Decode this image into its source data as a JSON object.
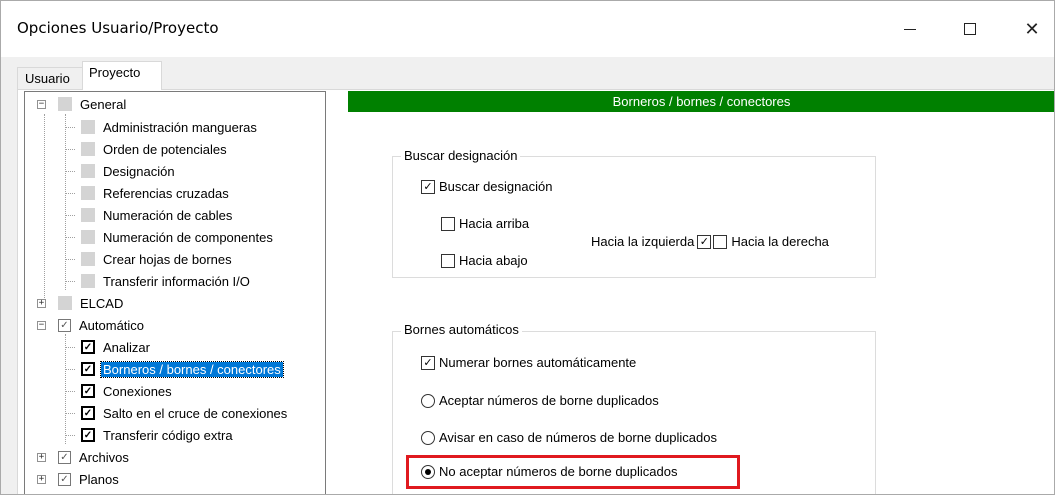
{
  "window": {
    "title": "Opciones Usuario/Proyecto"
  },
  "controls": {
    "minimize": "—",
    "maximize": "☐",
    "close": "✕"
  },
  "tabs": [
    "Usuario",
    "Proyecto"
  ],
  "tree": {
    "items": [
      {
        "label": "General",
        "type": "group"
      },
      {
        "label": "Administración mangueras"
      },
      {
        "label": "Orden de potenciales"
      },
      {
        "label": "Designación"
      },
      {
        "label": "Referencias cruzadas"
      },
      {
        "label": "Numeración de cables"
      },
      {
        "label": "Numeración de componentes"
      },
      {
        "label": "Crear hojas de bornes"
      },
      {
        "label": "Transferir información I/O"
      },
      {
        "label": "ELCAD"
      },
      {
        "label": "Automático"
      },
      {
        "label": "Analizar"
      },
      {
        "label": "Borneros / bornes / conectores"
      },
      {
        "label": "Conexiones"
      },
      {
        "label": "Salto en el cruce de conexiones"
      },
      {
        "label": "Transferir código extra"
      },
      {
        "label": "Archivos"
      },
      {
        "label": "Planos"
      }
    ]
  },
  "panel": {
    "header": "Borneros / bornes / conectores",
    "group1": {
      "title": "Buscar designación",
      "check_buscar": "Buscar designación",
      "check_arriba": "Hacia arriba",
      "check_abajo": "Hacia abajo",
      "label_izquierda": "Hacia la izquierda",
      "label_derecha": "Hacia la derecha"
    },
    "group2": {
      "title": "Bornes automáticos",
      "check_numerar": "Numerar bornes automáticamente",
      "radio_aceptar": "Aceptar números de borne duplicados",
      "radio_avisar": "Avisar en caso de números de borne duplicados",
      "radio_no_aceptar": "No aceptar números de borne duplicados"
    }
  },
  "colors": {
    "header_green": "#008000",
    "selection_blue": "#0078d7",
    "highlight_red": "#e0191f"
  }
}
